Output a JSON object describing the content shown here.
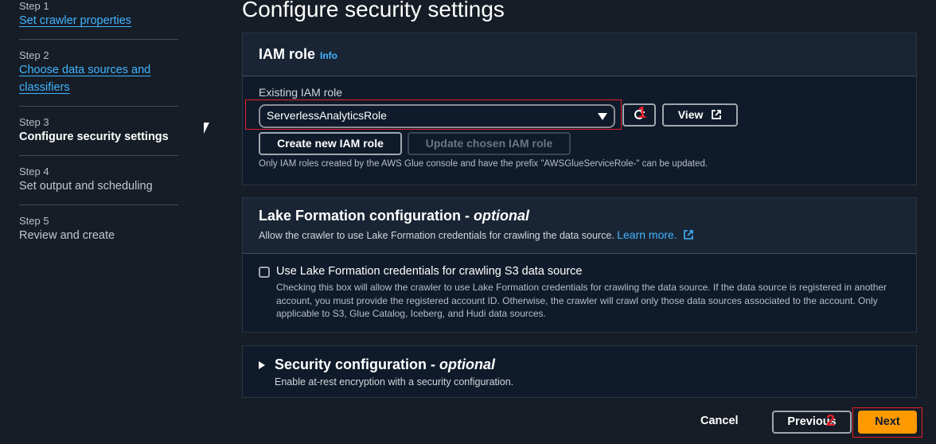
{
  "page": {
    "title": "Configure security settings"
  },
  "steps": [
    {
      "number": "Step 1",
      "title": "Set crawler properties",
      "state": "link"
    },
    {
      "number": "Step 2",
      "title": "Choose data sources and classifiers",
      "state": "link"
    },
    {
      "number": "Step 3",
      "title": "Configure security settings",
      "state": "active"
    },
    {
      "number": "Step 4",
      "title": "Set output and scheduling",
      "state": "pending"
    },
    {
      "number": "Step 5",
      "title": "Review and create",
      "state": "pending"
    }
  ],
  "iam": {
    "title": "IAM role",
    "info_label": "Info",
    "field_label": "Existing IAM role",
    "selected_role": "ServerlessAnalyticsRole",
    "view_label": "View",
    "create_label": "Create new IAM role",
    "update_label": "Update chosen IAM role",
    "hint": "Only IAM roles created by the AWS Glue console and have the prefix \"AWSGlueServiceRole-\" can be updated."
  },
  "lake_formation": {
    "title": "Lake Formation configuration - ",
    "optional": "optional",
    "description": "Allow the crawler to use Lake Formation credentials for crawling the data source.",
    "learn_more": "Learn more.",
    "checkbox_label": "Use Lake Formation credentials for crawling S3 data source",
    "checkbox_desc": "Checking this box will allow the crawler to use Lake Formation credentials for crawling the data source. If the data source is registered in another account, you must provide the registered account ID. Otherwise, the crawler will crawl only those data sources associated to the account. Only applicable to S3, Glue Catalog, Iceberg, and Hudi data sources."
  },
  "security": {
    "title": "Security configuration - ",
    "optional": "optional",
    "description": "Enable at-rest encryption with a security configuration."
  },
  "footer": {
    "cancel_label": "Cancel",
    "previous_label": "Previous",
    "next_label": "Next"
  },
  "annotations": {
    "one": "1",
    "two": "2"
  },
  "colors": {
    "accent": "#ff9900",
    "link": "#42b4ff",
    "annotation": "#e51e2a"
  }
}
